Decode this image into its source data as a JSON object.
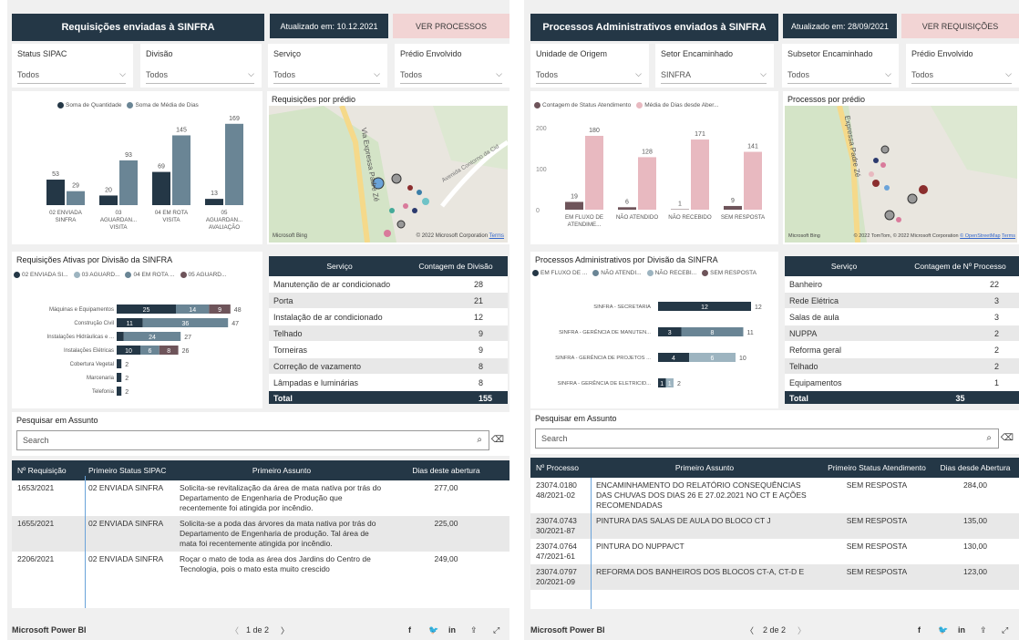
{
  "left": {
    "title": "Requisições enviadas à SINFRA",
    "updated": "Atualizado em: 10.12.2021",
    "button": "VER PROCESSOS",
    "slicers": [
      {
        "label": "Status SIPAC",
        "value": "Todos"
      },
      {
        "label": "Divisão",
        "value": "Todos"
      },
      {
        "label": "Serviço",
        "value": "Todos"
      },
      {
        "label": "Prédio Envolvido",
        "value": "Todos"
      }
    ],
    "bar_legend": [
      "Soma de Quantidade",
      "Soma de Média de Dias"
    ],
    "map_title": "Requisições por prédio",
    "map_labels": {
      "road1": "Via Expressa Padre Zé",
      "road2": "Avenida Contorno da Cid",
      "bing": "Microsoft Bing",
      "copy": "© 2022 Microsoft Corporation",
      "terms": "Terms"
    },
    "hbar_title": "Requisições Ativas por Divisão da SINFRA",
    "hbar_legend": [
      "02 ENVIADA SI...",
      "03 AGUARD...",
      "04 EM ROTA ...",
      "05 AGUARD..."
    ],
    "service_table": {
      "headers": [
        "Serviço",
        "Contagem de Divisão"
      ],
      "rows": [
        [
          "Manutenção de ar condicionado",
          "28"
        ],
        [
          "Porta",
          "21"
        ],
        [
          "Instalação de ar condicionado",
          "12"
        ],
        [
          "Telhado",
          "9"
        ],
        [
          "Torneiras",
          "9"
        ],
        [
          "Correção de vazamento",
          "8"
        ],
        [
          "Lâmpadas e luminárias",
          "8"
        ]
      ],
      "total": [
        "Total",
        "155"
      ]
    },
    "search_title": "Pesquisar em Assunto",
    "search_placeholder": "Search",
    "big_table": {
      "headers": [
        "Nº Requisição",
        "Primeiro Status SIPAC",
        "Primeiro Assunto",
        "Dias deste abertura"
      ],
      "rows": [
        {
          "id": "1653/2021",
          "status": "02 ENVIADA SINFRA",
          "subject": "Solicita-se revitalização da área de mata nativa por trás do Departamento de Engenharia de Produção que recentemente foi atingida por incêndio.",
          "days": "277,00"
        },
        {
          "id": "1655/2021",
          "status": "02 ENVIADA SINFRA",
          "subject": "Solicita-se a poda das árvores da mata nativa por trás do Departamento de Engenharia de produção. Tal área de mata foi recentemente atingida por incêndio.",
          "days": "225,00"
        },
        {
          "id": "2206/2021",
          "status": "02 ENVIADA SINFRA",
          "subject": "Roçar o mato de toda as área dos Jardins do Centro de Tecnologia, pois o mato esta muito crescido",
          "days": "249,00"
        }
      ]
    },
    "footer": {
      "brand": "Microsoft Power BI",
      "page": "1 de 2"
    }
  },
  "right": {
    "title": "Processos Administrativos enviados à SINFRA",
    "updated": "Atualizado em: 28/09/2021",
    "button": "VER REQUISIÇÕES",
    "slicers": [
      {
        "label": "Unidade de Origem",
        "value": "Todos"
      },
      {
        "label": "Setor Encaminhado",
        "value": "SINFRA"
      },
      {
        "label": "Subsetor Encaminhado",
        "value": "Todos"
      },
      {
        "label": "Prédio Envolvido",
        "value": "Todos"
      }
    ],
    "bar_legend": [
      "Contagem de Status Atendimento",
      "Média de Dias desde Aber..."
    ],
    "map_title": "Processos por prédio",
    "map_labels": {
      "road1": "Expressa Padre Zé",
      "copy": "© 2022 TomTom, © 2022 Microsoft Corporation",
      "osm": "© OpenStreetMap",
      "terms": "Terms",
      "bing": "Microsoft Bing"
    },
    "hbar_title": "Processos Administrativos por Divisão da SINFRA",
    "hbar_legend": [
      "EM FLUXO DE ...",
      "NÃO ATENDI...",
      "NÃO RECEBI...",
      "SEM RESPOSTA"
    ],
    "service_table": {
      "headers": [
        "Serviço",
        "Contagem de Nº Processo"
      ],
      "rows": [
        [
          "Banheiro",
          "22"
        ],
        [
          "Rede Elétrica",
          "3"
        ],
        [
          "Salas de aula",
          "3"
        ],
        [
          "NUPPA",
          "2"
        ],
        [
          "Reforma geral",
          "2"
        ],
        [
          "Telhado",
          "2"
        ],
        [
          "Equipamentos",
          "1"
        ]
      ],
      "total": [
        "Total",
        "35"
      ]
    },
    "search_title": "Pesquisar em Assunto",
    "search_placeholder": "Search",
    "big_table": {
      "headers": [
        "Nº Processo",
        "Primeiro Assunto",
        "Primeiro Status Atendimento",
        "Dias desde Abertura"
      ],
      "rows": [
        {
          "id": "23074.0180 48/2021-02",
          "subject": "ENCAMINHAMENTO DO RELATÓRIO CONSEQUÊNCIAS DAS CHUVAS DOS DIAS 26 E 27.02.2021 NO CT E AÇÕES RECOMENDADAS",
          "status": "SEM RESPOSTA",
          "days": "284,00"
        },
        {
          "id": "23074.0743 30/2021-87",
          "subject": "PINTURA DAS SALAS DE AULA DO BLOCO CT J",
          "status": "SEM RESPOSTA",
          "days": "135,00"
        },
        {
          "id": "23074.0764 47/2021-61",
          "subject": "PINTURA DO NUPPA/CT",
          "status": "SEM RESPOSTA",
          "days": "130,00"
        },
        {
          "id": "23074.0797 20/2021-09",
          "subject": "REFORMA DOS BANHEIROS DOS BLOCOS CT-A, CT-D E",
          "status": "SEM RESPOSTA",
          "days": "123,00"
        }
      ]
    },
    "footer": {
      "brand": "Microsoft Power BI",
      "page": "2 de 2"
    }
  },
  "colors": {
    "navy": "#243746",
    "slate": "#6a8595",
    "pink": "#e8b9c0",
    "mauve": "#6e545a",
    "lightblue": "#9db4c0"
  },
  "chart_data": [
    {
      "type": "bar",
      "title": "",
      "categories": [
        "02 ENVIADA SINFRA",
        "03 AGUARDAN... VISITA",
        "04 EM ROTA VISITA",
        "05 AGUARDAN... AVALIAÇÃO"
      ],
      "series": [
        {
          "name": "Soma de Quantidade",
          "values": [
            53,
            20,
            69,
            13
          ]
        },
        {
          "name": "Soma de Média de Dias",
          "values": [
            29,
            93,
            145,
            169
          ]
        }
      ]
    },
    {
      "type": "bar",
      "title": "",
      "categories": [
        "EM FLUXO DE ATENDIME...",
        "NÃO ATENDIDO",
        "NÃO RECEBIDO",
        "SEM RESPOSTA"
      ],
      "series": [
        {
          "name": "Contagem de Status Atendimento",
          "values": [
            19,
            6,
            1,
            9
          ]
        },
        {
          "name": "Média de Dias desde Aber...",
          "values": [
            180,
            128,
            171,
            141
          ]
        }
      ],
      "ylim": [
        0,
        200
      ],
      "yticks": [
        0,
        100,
        200
      ]
    },
    {
      "type": "bar",
      "orientation": "horizontal",
      "stacked": true,
      "title": "Requisições Ativas por Divisão da SINFRA",
      "categories": [
        "Máquinas e Equipamentos",
        "Construção Civil",
        "Instalações Hidráulicas e ...",
        "Instalações Elétricas",
        "Cobertura Vegetal",
        "Marcenaria",
        "Telefonia"
      ],
      "series": [
        {
          "name": "02 ENVIADA SI...",
          "values": [
            25,
            11,
            3,
            10,
            2,
            2,
            2
          ]
        },
        {
          "name": "03 AGUARD...",
          "values": [
            0,
            0,
            0,
            0,
            0,
            0,
            0
          ]
        },
        {
          "name": "04 EM ROTA ...",
          "values": [
            14,
            36,
            24,
            8,
            0,
            0,
            0
          ]
        },
        {
          "name": "05 AGUARD...",
          "values": [
            9,
            0,
            0,
            8,
            0,
            0,
            0
          ]
        }
      ],
      "totals": [
        48,
        47,
        27,
        26,
        2,
        2,
        2
      ],
      "segment_labels": [
        [
          "25",
          "14",
          "9"
        ],
        [
          "11",
          "36"
        ],
        [
          "3",
          "24"
        ],
        [
          "10",
          "6",
          "8"
        ],
        [],
        [],
        []
      ]
    },
    {
      "type": "bar",
      "orientation": "horizontal",
      "stacked": true,
      "title": "Processos Administrativos por Divisão da SINFRA",
      "categories": [
        "SINFRA - SECRETARIA",
        "SINFRA - GERÊNCIA DE MANUTEN...",
        "SINFRA - GERÊNCIA DE PROJETOS ...",
        "SINFRA - GERÊNCIA DE ELETRICID..."
      ],
      "series": [
        {
          "name": "EM FLUXO DE ...",
          "values": [
            12,
            3,
            4,
            1
          ]
        },
        {
          "name": "NÃO ATENDI...",
          "values": [
            0,
            8,
            0,
            0
          ]
        },
        {
          "name": "NÃO RECEBI...",
          "values": [
            0,
            0,
            6,
            1
          ]
        },
        {
          "name": "SEM RESPOSTA",
          "values": [
            0,
            0,
            0,
            0
          ]
        }
      ],
      "totals": [
        12,
        11,
        10,
        2
      ],
      "segment_labels": [
        [
          "12"
        ],
        [
          "3",
          "8"
        ],
        [
          "4",
          "6"
        ],
        [
          "1",
          "1"
        ]
      ]
    }
  ]
}
